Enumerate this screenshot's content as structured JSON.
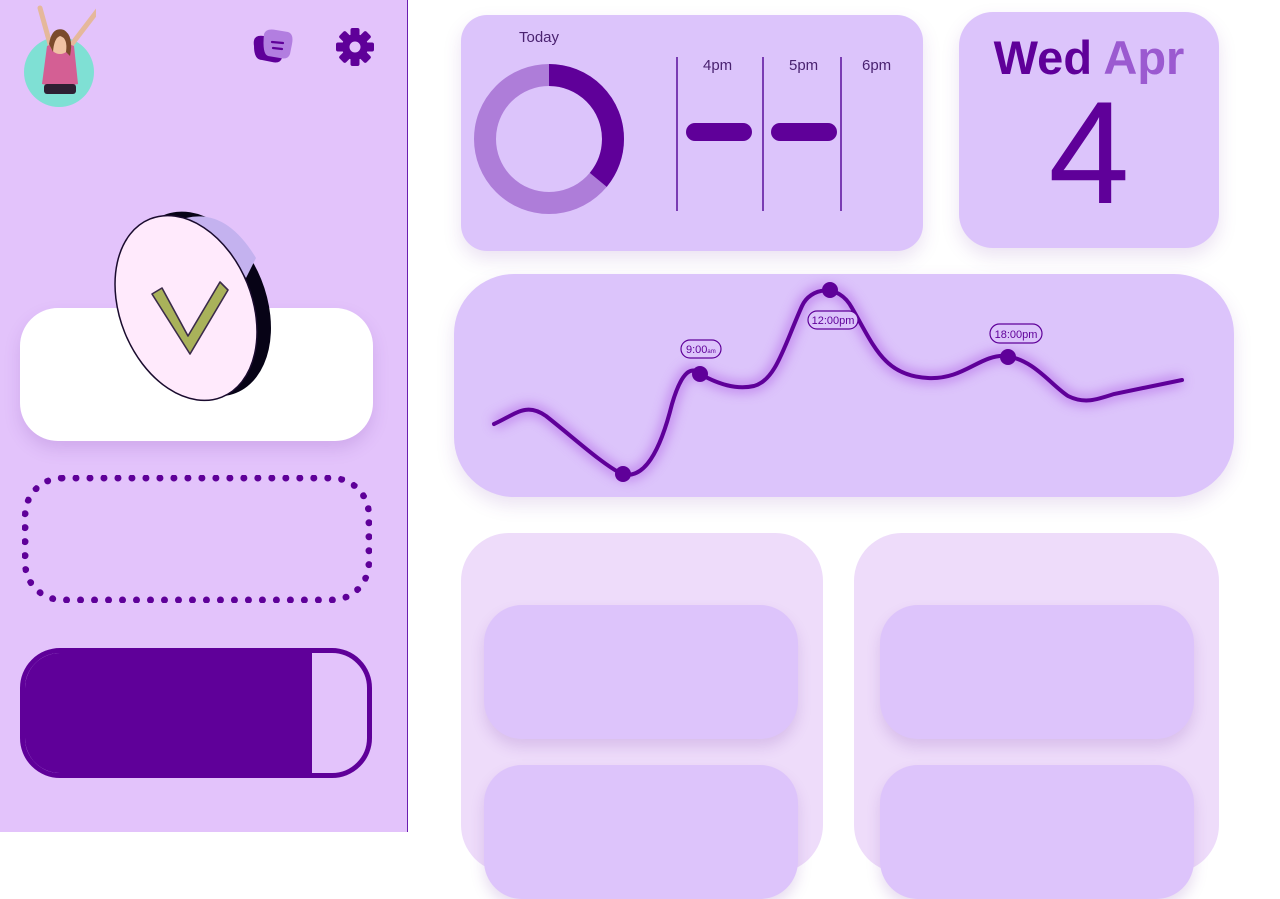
{
  "header": {
    "avatar": "avatar",
    "chat_icon": "chat-bubble-icon",
    "settings_icon": "gear-icon"
  },
  "today": {
    "label": "Today",
    "ring_progress": 0.36,
    "hours": [
      "4pm",
      "5pm",
      "6pm"
    ]
  },
  "date": {
    "weekday": "Wed",
    "month": "Apr",
    "day": "4"
  },
  "timeline": {
    "markers": [
      {
        "label": "9:00",
        "suffix": "am"
      },
      {
        "label": "12:00pm",
        "suffix": ""
      },
      {
        "label": "18:00pm",
        "suffix": ""
      }
    ]
  },
  "sidebar": {
    "progress": 0.84,
    "check_icon": "check-coin-icon"
  },
  "colors": {
    "primary": "#5f0099",
    "accent": "#9b5ad0",
    "sidebar_bg": "#e3c3fb",
    "card_bg": "#dcc4fb",
    "panel_bg": "#eedcfa",
    "check_green": "#a9b25a"
  }
}
